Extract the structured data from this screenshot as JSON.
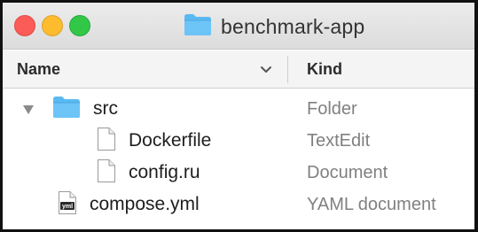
{
  "window": {
    "title": "benchmark-app",
    "folder_icon": "folder-icon"
  },
  "columns": {
    "name_label": "Name",
    "kind_label": "Kind",
    "sort_indicator": "chevron-down-icon"
  },
  "rows": [
    {
      "name": "src",
      "kind": "Folder",
      "icon": "folder-icon",
      "expanded": true,
      "level": 0
    },
    {
      "name": "Dockerfile",
      "kind": "TextEdit",
      "icon": "document-icon",
      "level": 1
    },
    {
      "name": "config.ru",
      "kind": "Document",
      "icon": "document-icon",
      "level": 1
    },
    {
      "name": "compose.yml",
      "kind": "YAML document",
      "icon": "yaml-file-icon",
      "icon_label": "yml",
      "level": 0
    }
  ],
  "colors": {
    "folder": "#52b6f0",
    "close": "#fc5c57",
    "minimize": "#fdbc2e",
    "maximize": "#33c748",
    "kind_text": "#808080"
  }
}
